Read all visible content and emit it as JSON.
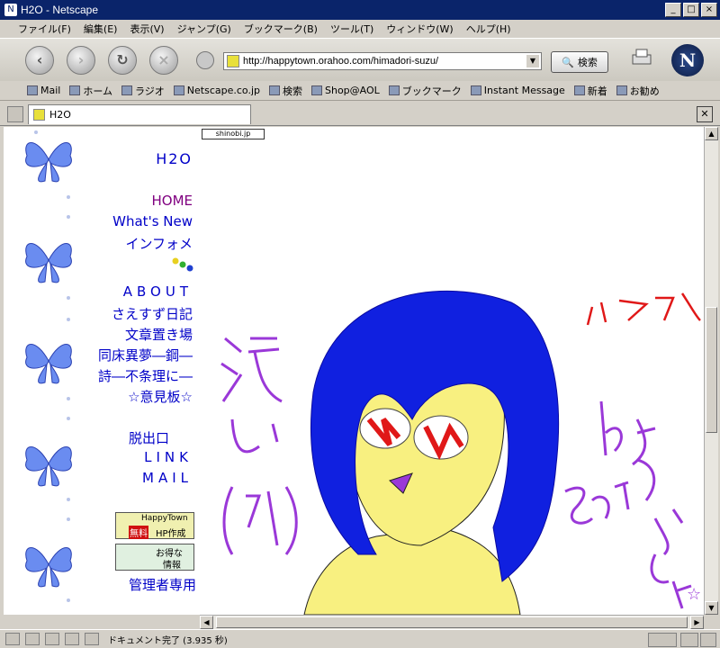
{
  "window": {
    "title": "H2O - Netscape",
    "controls": {
      "minimize": "_",
      "maximize": "□",
      "close": "×"
    }
  },
  "menu": [
    "ファイル(F)",
    "編集(E)",
    "表示(V)",
    "ジャンプ(G)",
    "ブックマーク(B)",
    "ツール(T)",
    "ウィンドウ(W)",
    "ヘルプ(H)"
  ],
  "nav": {
    "url": "http://happytown.orahoo.com/himadori-suzu/",
    "search_label": "検索",
    "logo_letter": "N",
    "back_icon": "‹",
    "forward_icon": "›",
    "reload_icon": "↻",
    "stop_icon": "×"
  },
  "personal_toolbar": [
    "Mail",
    "ホーム",
    "ラジオ",
    "Netscape.co.jp",
    "検索",
    "Shop@AOL",
    "ブックマーク",
    "Instant Message",
    "新着",
    "お勧め"
  ],
  "tab": {
    "label": "H2O"
  },
  "page": {
    "shinobi": "shinobi.jp",
    "site_title": "H2O",
    "links": {
      "home": "HOME",
      "whats_new": "What's New",
      "info": "インフォメ",
      "about": "ABOUT",
      "diary": "さえすず日記",
      "writings": "文章置き場",
      "dream": "同床異夢―鋼―",
      "poem": "詩―不条理に―",
      "board": "☆意見板☆",
      "exit": "脱出口",
      "link": "LINK",
      "mail": "MAIL",
      "admin": "管理者専用"
    },
    "banners": {
      "happytown_top": "HappyTown",
      "happytown_free": "無料",
      "happytown_make": "HP作成",
      "deal_1": "お得な",
      "deal_2": "情報"
    },
    "drawing_text": {
      "left": [
        "汚",
        "い",
        "(泣)"
      ],
      "right_top": "ハズカシ",
      "right_by": "by",
      "right_name": "そえむらすずね☆"
    }
  },
  "status": {
    "text": "ドキュメント完了 (3.935 秒)"
  },
  "colors": {
    "link": "#0000c8",
    "visited": "#800080",
    "hair": "#1020e0",
    "skin": "#f8f080",
    "ink_purple": "#9a38d8",
    "ink_red": "#e01818"
  }
}
